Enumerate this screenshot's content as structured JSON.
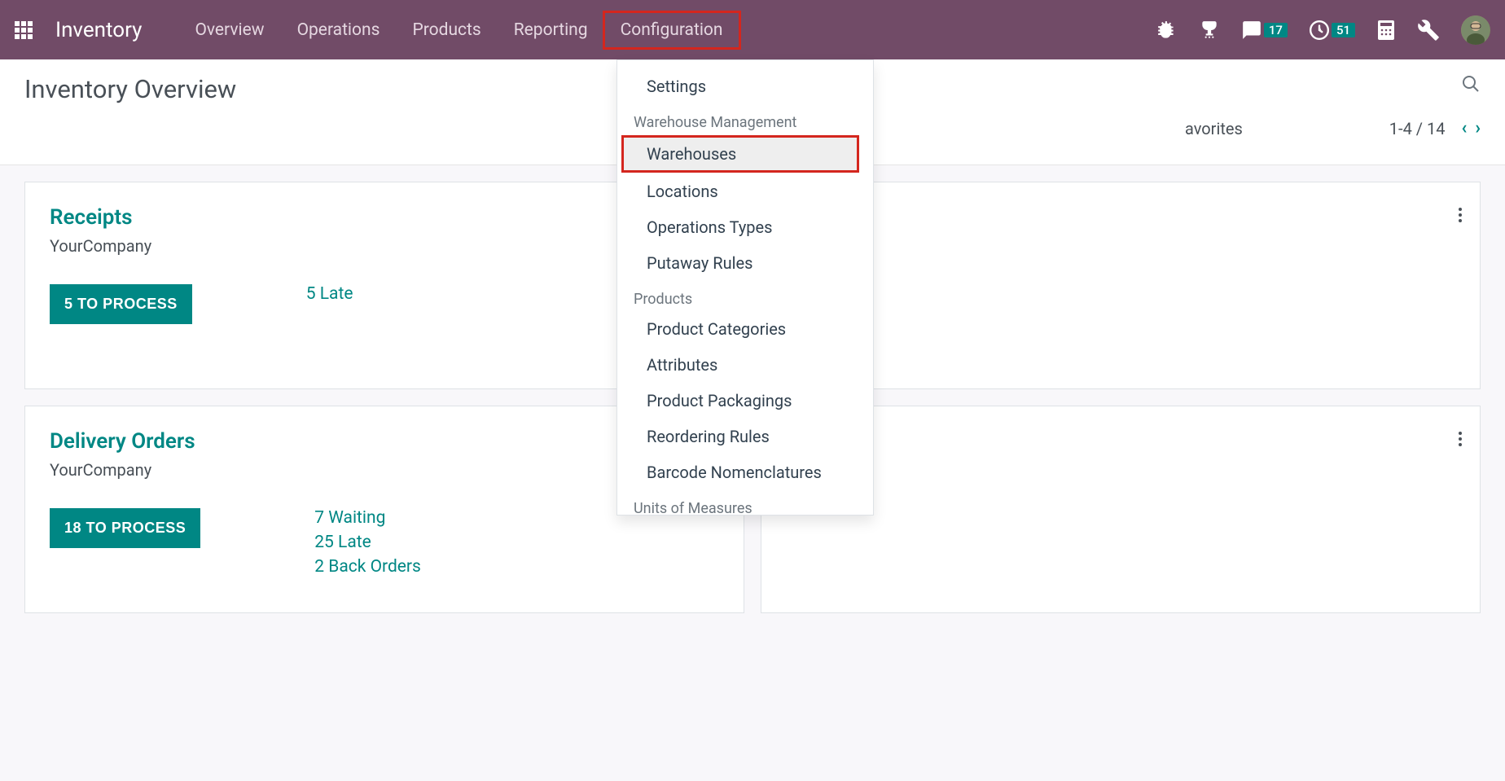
{
  "nav": {
    "brand": "Inventory",
    "links": [
      "Overview",
      "Operations",
      "Products",
      "Reporting",
      "Configuration"
    ],
    "badges": {
      "messages": "17",
      "activities": "51"
    }
  },
  "page": {
    "title": "Inventory Overview",
    "favorites_label": "avorites",
    "pager": "1-4 / 14"
  },
  "dropdown": {
    "settings": "Settings",
    "sections": [
      {
        "header": "Warehouse Management",
        "items": [
          "Warehouses",
          "Locations",
          "Operations Types",
          "Putaway Rules"
        ]
      },
      {
        "header": "Products",
        "items": [
          "Product Categories",
          "Attributes",
          "Product Packagings",
          "Reordering Rules",
          "Barcode Nomenclatures"
        ]
      },
      {
        "header": "Units of Measures",
        "items": []
      }
    ]
  },
  "cards": [
    {
      "title": "Receipts",
      "company": "YourCompany",
      "button": "5 TO PROCESS",
      "stats": [
        "5 Late"
      ]
    },
    {
      "title": "",
      "company": "",
      "button": "",
      "stats": []
    },
    {
      "title": "Delivery Orders",
      "company": "YourCompany",
      "button": "18 TO PROCESS",
      "stats": [
        "7 Waiting",
        "25 Late",
        "2 Back Orders"
      ]
    },
    {
      "title": "",
      "company": "",
      "button": "",
      "stats": []
    }
  ]
}
